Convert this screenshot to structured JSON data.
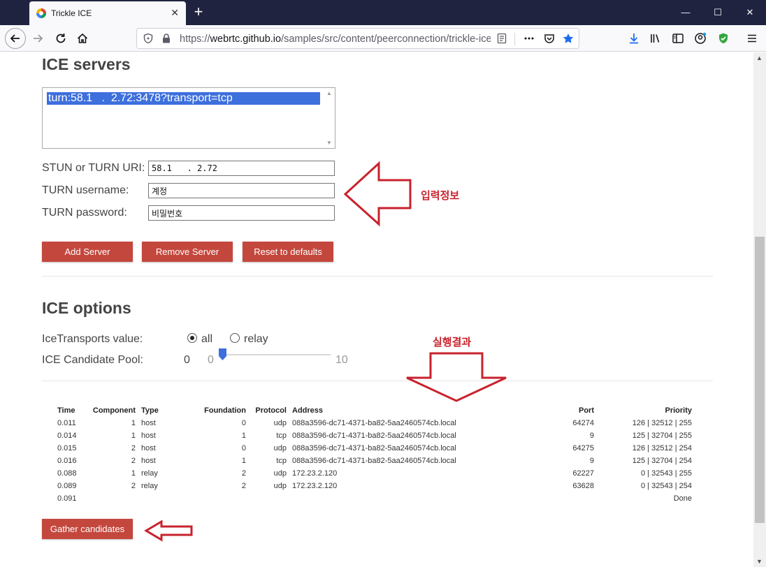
{
  "browser": {
    "tab_title": "Trickle ICE",
    "tab_close": "✕",
    "new_tab": "+",
    "window_controls": {
      "minimize": "—",
      "maximize": "☐",
      "close": "✕"
    },
    "url_prefix": "https://",
    "url_host": "webrtc.github.io",
    "url_path": "/samples/src/content/peerconnection/trickle-ice/"
  },
  "ice_servers": {
    "heading": "ICE servers",
    "server_list_selected": "turn:58.1   .  2.72:3478?transport=tcp",
    "uri_label": "STUN or TURN URI:",
    "uri_value": "58.1   . 2.72",
    "username_label": "TURN username:",
    "username_value": "계정",
    "password_label": "TURN password:",
    "password_value": "비밀번호",
    "add_button": "Add Server",
    "remove_button": "Remove Server",
    "reset_button": "Reset to defaults"
  },
  "ice_options": {
    "heading": "ICE options",
    "transports_label": "IceTransports value:",
    "transport_all": "all",
    "transport_relay": "relay",
    "transport_selected": "all",
    "pool_label": "ICE Candidate Pool:",
    "pool_value": "0",
    "pool_min": "0",
    "pool_max": "10"
  },
  "candidates": {
    "headers": [
      "Time",
      "Component",
      "Type",
      "Foundation",
      "Protocol",
      "Address",
      "Port",
      "Priority"
    ],
    "rows": [
      [
        "0.011",
        "1",
        "host",
        "0",
        "udp",
        "088a3596-dc71-4371-ba82-5aa2460574cb.local",
        "64274",
        "126 | 32512 | 255"
      ],
      [
        "0.014",
        "1",
        "host",
        "1",
        "tcp",
        "088a3596-dc71-4371-ba82-5aa2460574cb.local",
        "9",
        "125 | 32704 | 255"
      ],
      [
        "0.015",
        "2",
        "host",
        "0",
        "udp",
        "088a3596-dc71-4371-ba82-5aa2460574cb.local",
        "64275",
        "126 | 32512 | 254"
      ],
      [
        "0.016",
        "2",
        "host",
        "1",
        "tcp",
        "088a3596-dc71-4371-ba82-5aa2460574cb.local",
        "9",
        "125 | 32704 | 254"
      ],
      [
        "0.088",
        "1",
        "relay",
        "2",
        "udp",
        "172.23.2.120",
        "62227",
        "0 | 32543 | 255"
      ],
      [
        "0.089",
        "2",
        "relay",
        "2",
        "udp",
        "172.23.2.120",
        "63628",
        "0 | 32543 | 254"
      ]
    ],
    "final_time": "0.091",
    "final_status": "Done"
  },
  "gather_button": "Gather candidates",
  "annotations": {
    "input_info": "입력정보",
    "result": "실행결과"
  },
  "colors": {
    "accent_button": "#c4473d",
    "annotation_red": "#c8222c",
    "selection_blue": "#3d6fdd",
    "titlebar": "#202340"
  }
}
